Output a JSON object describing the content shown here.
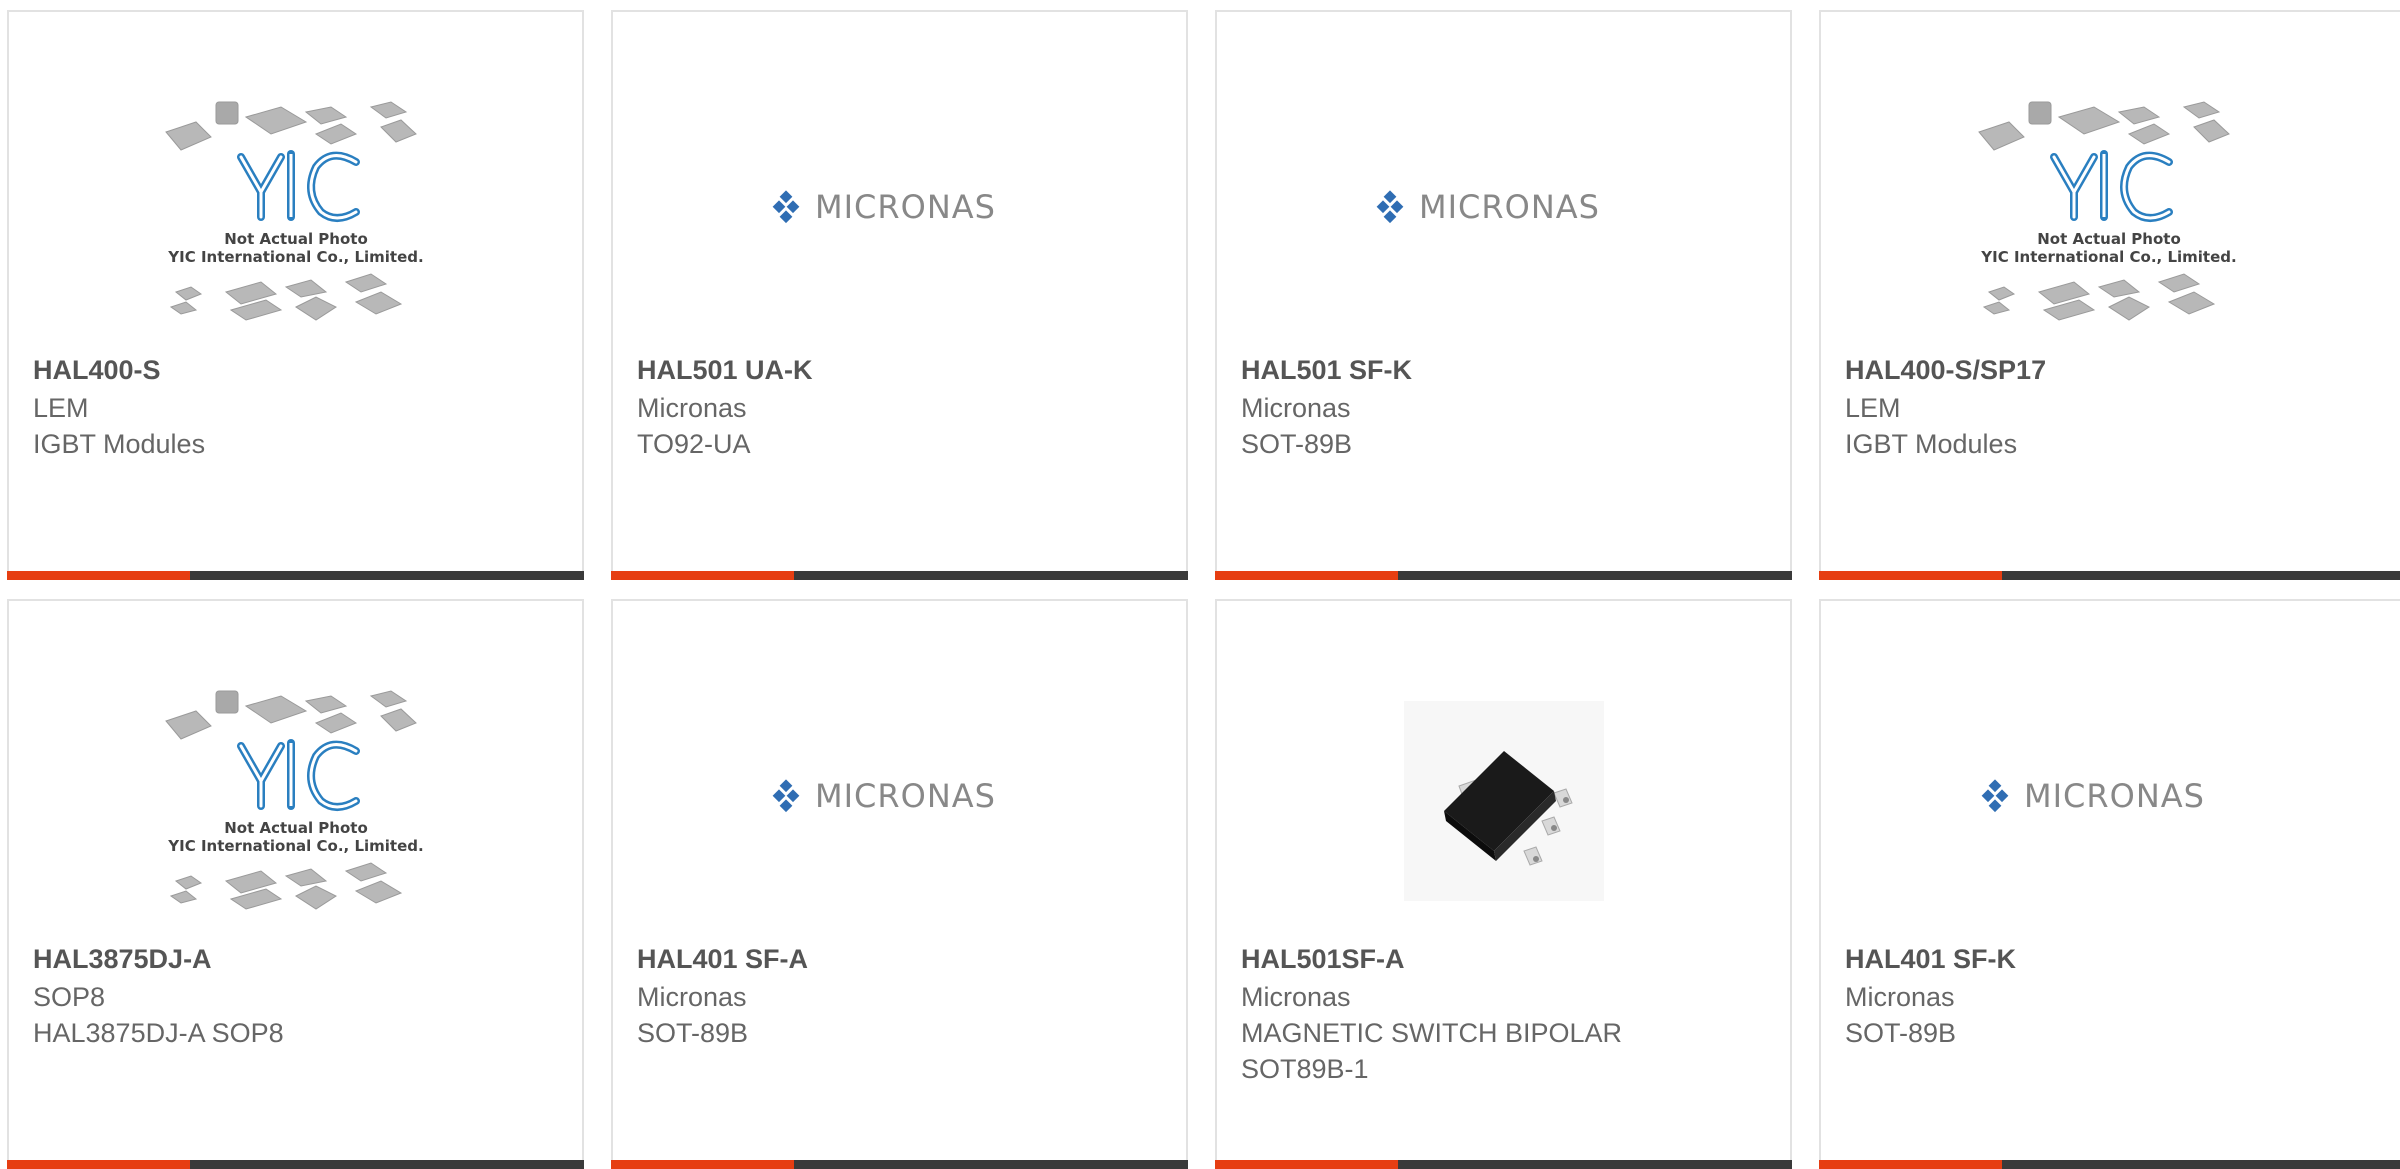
{
  "products": [
    {
      "part": "HAL400-S",
      "line1": "LEM",
      "line2": "IGBT Modules",
      "line3": "",
      "image": "yic-placeholder",
      "image_text_1": "Not Actual Photo",
      "image_text_2": "YIC International Co., Limited."
    },
    {
      "part": "HAL501 UA-K",
      "line1": "Micronas",
      "line2": "TO92-UA",
      "line3": "",
      "image": "micronas-logo",
      "logo_text": "MICRONAS"
    },
    {
      "part": "HAL501 SF-K",
      "line1": "Micronas",
      "line2": "SOT-89B",
      "line3": "",
      "image": "micronas-logo",
      "logo_text": "MICRONAS"
    },
    {
      "part": "HAL400-S/SP17",
      "line1": "LEM",
      "line2": "IGBT Modules",
      "line3": "",
      "image": "yic-placeholder",
      "image_text_1": "Not Actual Photo",
      "image_text_2": "YIC International Co., Limited."
    },
    {
      "part": "HAL3875DJ-A",
      "line1": "SOP8",
      "line2": "HAL3875DJ-A SOP8",
      "line3": "",
      "image": "yic-placeholder",
      "image_text_1": "Not Actual Photo",
      "image_text_2": "YIC International Co., Limited."
    },
    {
      "part": "HAL401 SF-A",
      "line1": "Micronas",
      "line2": "SOT-89B",
      "line3": "",
      "image": "micronas-logo",
      "logo_text": "MICRONAS"
    },
    {
      "part": "HAL501SF-A",
      "line1": "Micronas",
      "line2": "MAGNETIC SWITCH BIPOLAR",
      "line3": "SOT89B-1",
      "image": "chip-photo"
    },
    {
      "part": "HAL401 SF-K",
      "line1": "Micronas",
      "line2": "SOT-89B",
      "line3": "",
      "image": "micronas-logo",
      "logo_text": "MICRONAS"
    }
  ],
  "colors": {
    "accent": "#e63e12",
    "bar": "#3a3a3a",
    "micronas_blue": "#2f6db3",
    "yic_blue": "#2a7fc0"
  }
}
